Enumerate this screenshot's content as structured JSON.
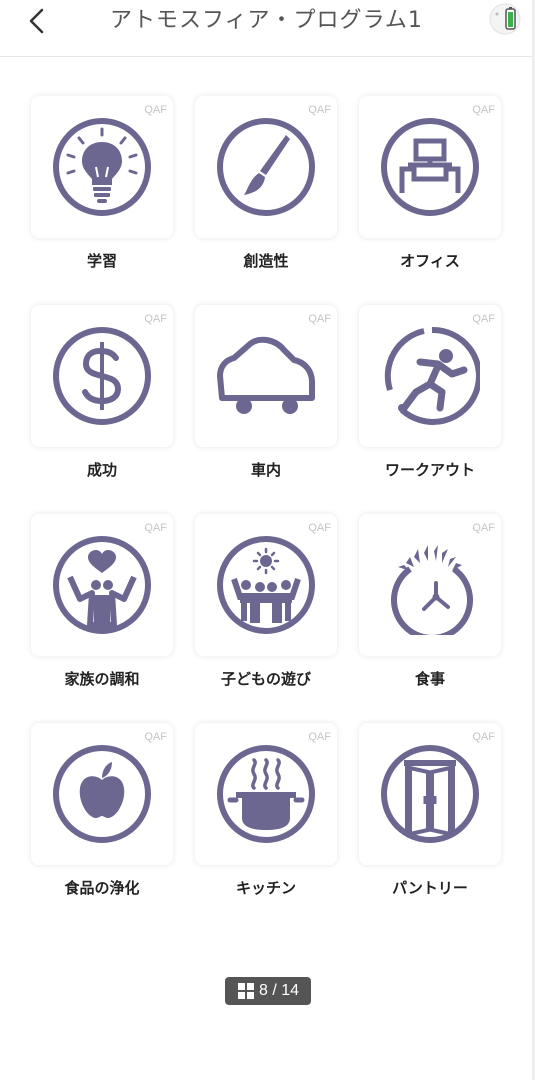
{
  "header": {
    "title": "アトモスフィア・プログラム1",
    "back_icon": "chevron-left-icon",
    "battery_icon": "battery-icon"
  },
  "colors": {
    "icon": "#6b6790",
    "tile_bg": "#ffffff",
    "pager_bg": "#555555",
    "battery": "#3cb04a"
  },
  "programs": [
    {
      "badge": "QAF",
      "label": "学習",
      "icon": "lightbulb-icon"
    },
    {
      "badge": "QAF",
      "label": "創造性",
      "icon": "paintbrush-icon"
    },
    {
      "badge": "QAF",
      "label": "オフィス",
      "icon": "office-desk-icon"
    },
    {
      "badge": "QAF",
      "label": "成功",
      "icon": "dollar-icon"
    },
    {
      "badge": "QAF",
      "label": "車内",
      "icon": "car-icon"
    },
    {
      "badge": "QAF",
      "label": "ワークアウト",
      "icon": "running-person-icon"
    },
    {
      "badge": "QAF",
      "label": "家族の調和",
      "icon": "family-heart-icon"
    },
    {
      "badge": "QAF",
      "label": "子どもの遊び",
      "icon": "children-sun-icon"
    },
    {
      "badge": "QAF",
      "label": "食事",
      "icon": "meal-icon"
    },
    {
      "badge": "QAF",
      "label": "食品の浄化",
      "icon": "apple-icon"
    },
    {
      "badge": "QAF",
      "label": "キッチン",
      "icon": "cooking-pot-icon"
    },
    {
      "badge": "QAF",
      "label": "パントリー",
      "icon": "pantry-doors-icon"
    }
  ],
  "pager": {
    "icon": "grid-icon",
    "text": "8 / 14"
  }
}
